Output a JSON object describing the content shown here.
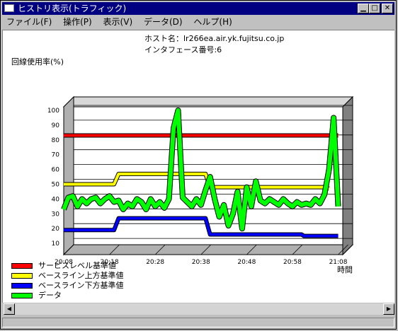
{
  "window": {
    "title": "ヒストリ表示(トラフィック)"
  },
  "menu": [
    "ファイル(F)",
    "操作(P)",
    "表示(V)",
    "データ(D)",
    "ヘルプ(H)"
  ],
  "header": {
    "host_label": "ホスト名：lr266ea.air.yk.fujitsu.co.jp",
    "interface_label": "インタフェース番号:6"
  },
  "chart_data": {
    "type": "line",
    "ylabel": "回線使用率(%)",
    "xlabel": "時間",
    "ylim": [
      0,
      100
    ],
    "yticks": [
      10,
      20,
      30,
      40,
      50,
      60,
      70,
      80,
      90,
      100
    ],
    "xticks": [
      "20:08",
      "20:18",
      "20:28",
      "20:38",
      "20:48",
      "20:58",
      "21:08"
    ],
    "x_start_min": 0,
    "x_end_min": 61,
    "series": [
      {
        "name": "サービスレベル基準値",
        "color": "#ff0000",
        "points": [
          [
            0,
            83
          ],
          [
            60,
            83
          ]
        ]
      },
      {
        "name": "ベースライン上方基準値",
        "color": "#ffff00",
        "points": [
          [
            0,
            50
          ],
          [
            11,
            50
          ],
          [
            12,
            57
          ],
          [
            31,
            57
          ],
          [
            32,
            48
          ],
          [
            57,
            48
          ],
          [
            58,
            47
          ]
        ]
      },
      {
        "name": "ベースライン下方基準値",
        "color": "#0000ff",
        "points": [
          [
            0,
            19
          ],
          [
            11,
            19
          ],
          [
            12,
            27
          ],
          [
            31,
            27
          ],
          [
            32,
            16
          ],
          [
            52,
            16
          ],
          [
            52.5,
            15
          ],
          [
            60,
            15
          ]
        ]
      },
      {
        "name": "データ",
        "color": "#00ff00",
        "points": [
          [
            0,
            33
          ],
          [
            1,
            41
          ],
          [
            2,
            42
          ],
          [
            3,
            35
          ],
          [
            4,
            40
          ],
          [
            5,
            37
          ],
          [
            6,
            40
          ],
          [
            7,
            41
          ],
          [
            8,
            37
          ],
          [
            9,
            40
          ],
          [
            10,
            42
          ],
          [
            11,
            38
          ],
          [
            12,
            39
          ],
          [
            13,
            33
          ],
          [
            14,
            37
          ],
          [
            15,
            35
          ],
          [
            16,
            40
          ],
          [
            17,
            38
          ],
          [
            18,
            33
          ],
          [
            19,
            40
          ],
          [
            20,
            35
          ],
          [
            21,
            38
          ],
          [
            22,
            34
          ],
          [
            23,
            40
          ],
          [
            24,
            88
          ],
          [
            25,
            100
          ],
          [
            26,
            41
          ],
          [
            27,
            38
          ],
          [
            28,
            35
          ],
          [
            29,
            40
          ],
          [
            30,
            36
          ],
          [
            31,
            46
          ],
          [
            32,
            55
          ],
          [
            33,
            40
          ],
          [
            34,
            28
          ],
          [
            35,
            36
          ],
          [
            36,
            22
          ],
          [
            37,
            30
          ],
          [
            38,
            45
          ],
          [
            39,
            20
          ],
          [
            40,
            48
          ],
          [
            41,
            35
          ],
          [
            42,
            52
          ],
          [
            43,
            39
          ],
          [
            44,
            37
          ],
          [
            45,
            40
          ],
          [
            46,
            38
          ],
          [
            47,
            36
          ],
          [
            48,
            40
          ],
          [
            49,
            37
          ],
          [
            50,
            35
          ],
          [
            51,
            38
          ],
          [
            52,
            36
          ],
          [
            53,
            37
          ],
          [
            54,
            36
          ],
          [
            55,
            40
          ],
          [
            56,
            37
          ],
          [
            57,
            43
          ],
          [
            58,
            60
          ],
          [
            59,
            95
          ],
          [
            60,
            35
          ]
        ]
      }
    ]
  }
}
